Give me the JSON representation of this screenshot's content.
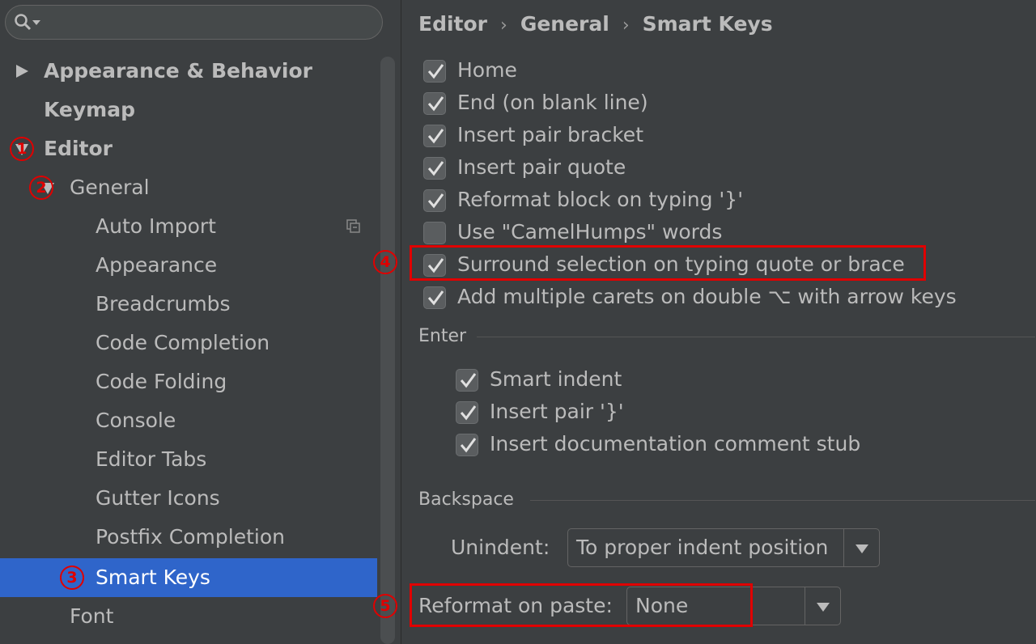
{
  "sidebar": {
    "search": {
      "placeholder": ""
    },
    "items": [
      {
        "label": "Appearance & Behavior"
      },
      {
        "label": "Keymap"
      },
      {
        "label": "Editor"
      },
      {
        "label": "General"
      },
      {
        "label": "Auto Import"
      },
      {
        "label": "Appearance"
      },
      {
        "label": "Breadcrumbs"
      },
      {
        "label": "Code Completion"
      },
      {
        "label": "Code Folding"
      },
      {
        "label": "Console"
      },
      {
        "label": "Editor Tabs"
      },
      {
        "label": "Gutter Icons"
      },
      {
        "label": "Postfix Completion"
      },
      {
        "label": "Smart Keys"
      },
      {
        "label": "Font"
      }
    ],
    "selected": "Smart Keys"
  },
  "badges": {
    "b1": "1",
    "b2": "2",
    "b3": "3",
    "b4": "4",
    "b5": "5"
  },
  "breadcrumb": {
    "part1": "Editor",
    "part2": "General",
    "part3": "Smart Keys",
    "separator": "›"
  },
  "options": [
    {
      "label": "Home",
      "checked": true
    },
    {
      "label": "End (on blank line)",
      "checked": true
    },
    {
      "label": "Insert pair bracket",
      "checked": true
    },
    {
      "label": "Insert pair quote",
      "checked": true
    },
    {
      "label": "Reformat block on typing '}'",
      "checked": true
    },
    {
      "label": "Use \"CamelHumps\" words",
      "checked": false
    },
    {
      "label": "Surround selection on typing quote or brace",
      "checked": true
    },
    {
      "label": "Add multiple carets on double ⌥ with arrow keys",
      "checked": true
    }
  ],
  "enter": {
    "title": "Enter",
    "options": [
      {
        "label": "Smart indent",
        "checked": true
      },
      {
        "label": "Insert pair '}'",
        "checked": true
      },
      {
        "label": "Insert documentation comment stub",
        "checked": true
      }
    ]
  },
  "backspace": {
    "title": "Backspace",
    "unindent_label": "Unindent:",
    "unindent_value": "To proper indent position"
  },
  "reformat": {
    "label": "Reformat on paste:",
    "value": "None"
  },
  "colors": {
    "selection": "#2f65ca",
    "highlight": "#e00000",
    "background": "#3c3f41"
  }
}
